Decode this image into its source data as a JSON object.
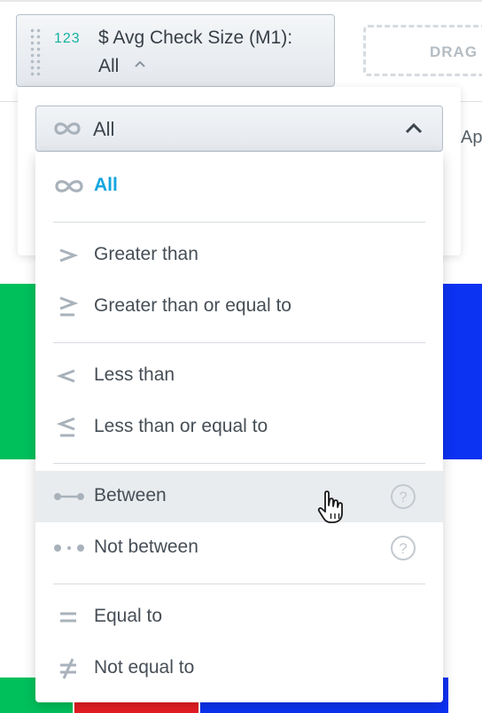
{
  "chip": {
    "type_badge": "123",
    "title": "$ Avg Check Size (M1):",
    "value": "All"
  },
  "drag_placeholder": {
    "label": "DRAG"
  },
  "side_label": "Ap",
  "filter_select": {
    "selected": "All"
  },
  "options": [
    {
      "label": "All",
      "icon": "infinity-icon",
      "state": "selected"
    },
    {
      "label": "Greater than",
      "icon": "greater-than-icon"
    },
    {
      "label": "Greater than or equal to",
      "icon": "greater-or-equal-icon"
    },
    {
      "label": "Less than",
      "icon": "less-than-icon"
    },
    {
      "label": "Less than or equal to",
      "icon": "less-or-equal-icon"
    },
    {
      "label": "Between",
      "icon": "between-icon",
      "state": "hovered",
      "help": "?"
    },
    {
      "label": "Not between",
      "icon": "not-between-icon",
      "help": "?"
    },
    {
      "label": "Equal to",
      "icon": "equal-icon"
    },
    {
      "label": "Not equal to",
      "icon": "not-equal-icon"
    }
  ],
  "colors": {
    "accent": "#14a6df",
    "type_badge": "#14b2a4",
    "chart_green": "#00c05b",
    "chart_red": "#e51c23",
    "chart_blue": "#0c32f2"
  }
}
